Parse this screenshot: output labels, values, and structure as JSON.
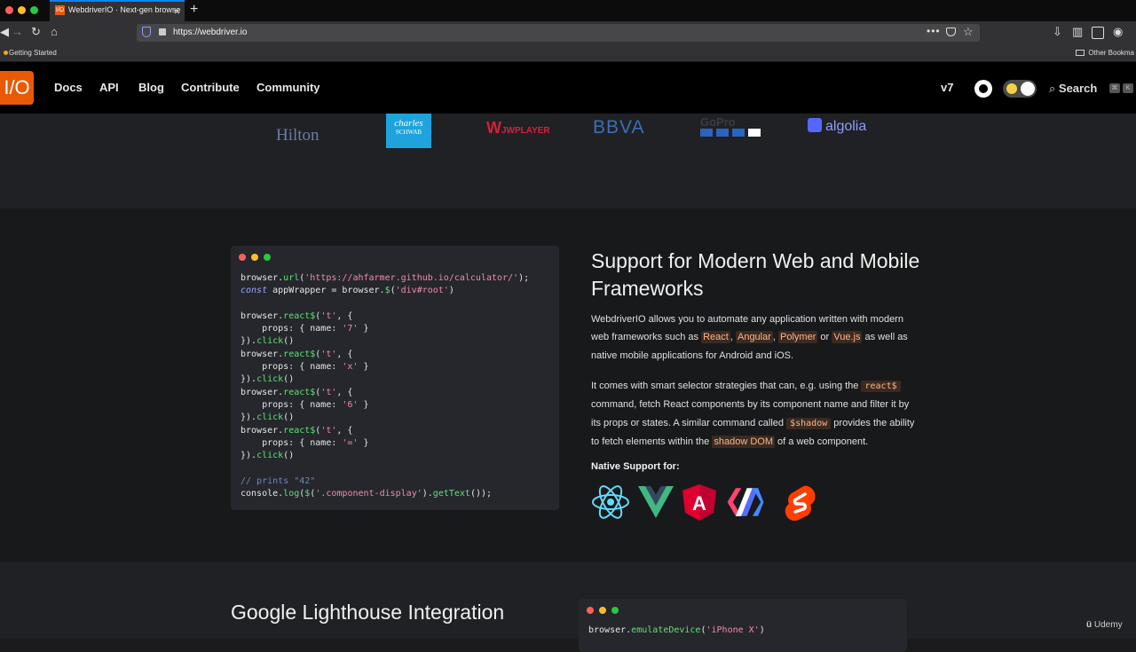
{
  "browser": {
    "tab_title": "WebdriverIO · Next-gen browse",
    "tab_favicon": "I/O",
    "url": "https://webdriver.io",
    "bookmark_left": "Getting Started",
    "bookmark_right": "Other Bookma"
  },
  "site_nav": {
    "logo": "I/O",
    "links": [
      "Docs",
      "API",
      "Blog",
      "Contribute",
      "Community"
    ],
    "version": "v7",
    "search_label": "Search",
    "search_keys": [
      "⌘",
      "K"
    ]
  },
  "sponsors": [
    "Hilton",
    "charles",
    "SCHWAB",
    "JWPLAYER",
    "BBVA",
    "GoPro",
    "algolia"
  ],
  "feature": {
    "title": "Support for Modern Web and Mobile Frameworks",
    "p1_a": "WebdriverIO allows you to automate any application written with modern web frameworks such as ",
    "react": "React",
    "comma1": ", ",
    "angular": "Angular",
    "comma2": ", ",
    "polymer": "Polymer",
    "or": " or ",
    "vue": "Vue.js",
    "p1_b": " as well as native mobile applications for Android and iOS.",
    "p2_a": "It comes with smart selector strategies that can, e.g. using the ",
    "react_cmd": "react$",
    "p2_b": " command, fetch React components by its component name and filter it by its props or states. A similar command called ",
    "shadow_cmd": "$shadow",
    "p2_c": " provides the ability to fetch elements within the ",
    "shadow_dom": "shadow DOM",
    "p2_d": " of a web component.",
    "native_label": "Native Support for:",
    "frameworks": [
      "react-icon",
      "vue-icon",
      "angular-icon",
      "polymer-icon",
      "svelte-icon"
    ]
  },
  "code": {
    "l1_a": "browser.",
    "l1_fn": "url",
    "l1_b": "(",
    "l1_str": "'https://ahfarmer.github.io/calculator/'",
    "l1_c": ");",
    "l2_kw": "const",
    "l2_a": " appWrapper = browser.",
    "l2_fn": "$",
    "l2_b": "(",
    "l2_str": "'div#root'",
    "l2_c": ")",
    "blocks": [
      {
        "a": "browser.",
        "fn": "react$",
        "b": "(",
        "s1": "'t'",
        "c": ", {",
        "props": "    props: { name: ",
        "s2": "'7'",
        "pe": " }",
        "end": "}).",
        "click": "click",
        "ce": "()"
      },
      {
        "a": "browser.",
        "fn": "react$",
        "b": "(",
        "s1": "'t'",
        "c": ", {",
        "props": "    props: { name: ",
        "s2": "'x'",
        "pe": " }",
        "end": "}).",
        "click": "click",
        "ce": "()"
      },
      {
        "a": "browser.",
        "fn": "react$",
        "b": "(",
        "s1": "'t'",
        "c": ", {",
        "props": "    props: { name: ",
        "s2": "'6'",
        "pe": " }",
        "end": "}).",
        "click": "click",
        "ce": "()"
      },
      {
        "a": "browser.",
        "fn": "react$",
        "b": "(",
        "s1": "'t'",
        "c": ", {",
        "props": "    props: { name: ",
        "s2": "'='",
        "pe": " }",
        "end": "}).",
        "click": "click",
        "ce": "()"
      }
    ],
    "comment": "// prints \"42\"",
    "last_a": "console.",
    "last_fn": "log",
    "last_b": "(",
    "last_fn2": "$",
    "last_c": "(",
    "last_str": "'.component-display'",
    "last_d": ").",
    "last_fn3": "getText",
    "last_e": "());"
  },
  "lighthouse": {
    "title": "Google Lighthouse Integration",
    "code_a": "browser.",
    "code_fn": "emulateDevice",
    "code_b": "(",
    "code_str": "'iPhone X'",
    "code_c": ")"
  },
  "watermark": "Udemy",
  "colors": {
    "brand": "#ea5906",
    "code_fn": "#5fe36e",
    "code_str": "#f28aa8"
  }
}
